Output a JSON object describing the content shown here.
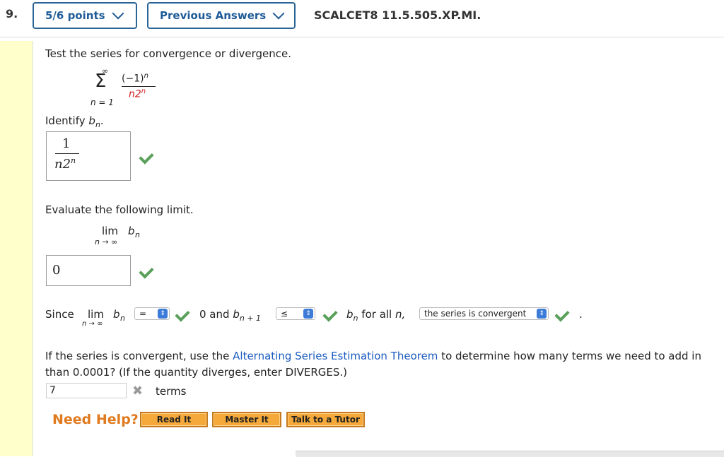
{
  "header": {
    "question_number": "9.",
    "points_label": "5/6 points",
    "previous_answers_label": "Previous Answers",
    "problem_code": "SCALCET8 11.5.505.XP.MI."
  },
  "question": {
    "instruction": "Test the series for convergence or divergence.",
    "series": {
      "sigma": "Σ",
      "upper": "∞",
      "lower": "n = 1",
      "numerator": "(−1)",
      "numerator_exp": "n",
      "denominator_base": "n2",
      "denominator_exp": "n"
    },
    "identify_prompt": "Identify",
    "identify_var": "b",
    "identify_sub": "n",
    "identify_end": ".",
    "answer1": {
      "numerator": "1",
      "denominator": "n2",
      "denominator_exp": "n"
    },
    "limit_prompt": "Evaluate the following limit.",
    "limit_expr": {
      "lim": "lim",
      "var": "b",
      "sub": "n",
      "under": "n → ∞"
    },
    "answer2_value": "0",
    "since": {
      "since_label": "Since",
      "lim": "lim",
      "var": "b",
      "sub": "n",
      "under": "n → ∞",
      "select1": "=",
      "mid_text": "0 and",
      "var2": "b",
      "sub2": "n + 1",
      "select2": "≤",
      "var3": "b",
      "sub3": "n",
      "tail_text": "for all",
      "tail_var": "n,",
      "select3": "the series is convergent",
      "end": "."
    },
    "estimation": {
      "text_before_link": "If the series is convergent, use the",
      "link_text": "Alternating Series Estimation Theorem",
      "text_after_link": "to determine how many terms we need to add in",
      "line2": "than 0.0001? (If the quantity diverges, enter DIVERGES.)",
      "input_value": "7",
      "unit": "terms"
    }
  },
  "help": {
    "label": "Need Help?",
    "read_it": "Read It",
    "master_it": "Master It",
    "talk_to_tutor": "Talk to a Tutor"
  },
  "colors": {
    "check_green": "#5aa05a",
    "help_orange": "#e07a1f",
    "link_blue": "#1a5bbf",
    "button_orange": "#f4a93a"
  }
}
